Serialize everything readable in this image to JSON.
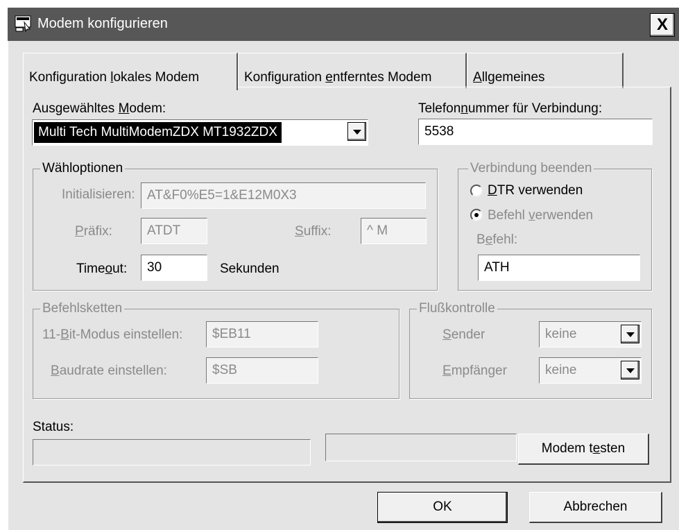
{
  "window": {
    "title": "Modem konfigurieren",
    "close_label": "X"
  },
  "tabs": [
    {
      "pre": "Konfiguration ",
      "key": "l",
      "post": "okales Modem",
      "active": true
    },
    {
      "pre": "Konfiguration ",
      "key": "e",
      "post": "ntferntes Modem",
      "active": false
    },
    {
      "pre": "",
      "key": "A",
      "post": "llgemeines",
      "active": false
    }
  ],
  "modem": {
    "label_pre": "Ausgewähltes ",
    "label_key": "M",
    "label_post": "odem:",
    "selected": "Multi Tech MultiModemZDX MT1932ZDX"
  },
  "phone": {
    "label_pre": "Telefon",
    "label_key": "n",
    "label_post": "ummer für Verbindung:",
    "value": "5538"
  },
  "dial": {
    "title": "Wähloptionen",
    "init_label": "Initialisieren:",
    "init_value": "AT&F0%E5=1&E12M0X3",
    "prefix_key": "P",
    "prefix_post": "räfix:",
    "prefix_value": "ATDT",
    "suffix_key": "S",
    "suffix_post": "uffix:",
    "suffix_value": "^ M",
    "timeout_pre": "Time",
    "timeout_key": "o",
    "timeout_post": "ut:",
    "timeout_value": "30",
    "timeout_unit": "Sekunden"
  },
  "hangup": {
    "title": "Verbindung beenden",
    "dtr_key": "D",
    "dtr_post": "TR verwenden",
    "cmd_pre": "Befehl ",
    "cmd_key": "v",
    "cmd_post": "erwenden",
    "befehl_pre": "B",
    "befehl_key": "e",
    "befehl_post": "fehl:",
    "befehl_value": "ATH",
    "selected": "cmd"
  },
  "strings": {
    "title": "Befehlsketten",
    "bit_pre": "11-",
    "bit_key": "B",
    "bit_post": "it-Modus einstellen:",
    "bit_value": "$EB11",
    "baud_key": "B",
    "baud_post": "audrate einstellen:",
    "baud_value": "$SB"
  },
  "flow": {
    "title": "Flußkontrolle",
    "sender_key": "S",
    "sender_post": "ender",
    "sender_value": "keine",
    "receiver_key": "E",
    "receiver_post": "mpfänger",
    "receiver_value": "keine"
  },
  "status": {
    "label": "Status:",
    "test_pre": "Modem t",
    "test_key": "e",
    "test_post": "sten"
  },
  "footer": {
    "ok_label": "OK",
    "cancel_label": "Abbrechen"
  },
  "colors": {
    "titlebar": "#575757",
    "dialog_bg": "#e4e4e4",
    "selection": "#000000"
  }
}
